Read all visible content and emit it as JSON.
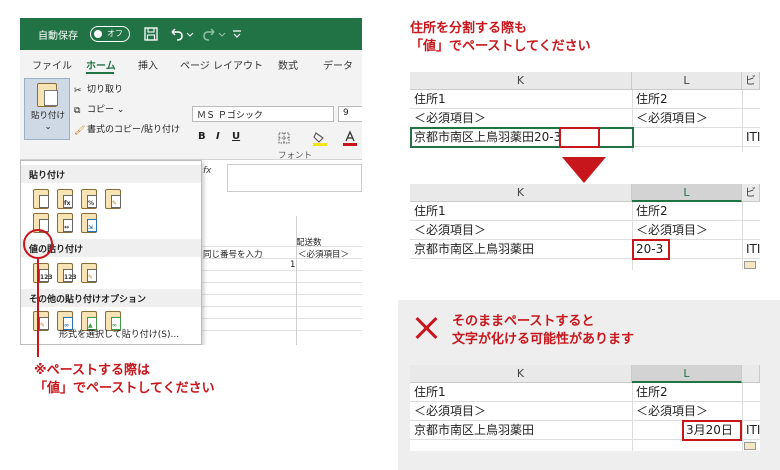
{
  "excel": {
    "titlebar": {
      "autosave": "自動保存",
      "toggle": "オフ",
      "save_icon": "save-icon",
      "undo_icon": "undo-icon"
    },
    "tabs": [
      "ファイル",
      "ホーム",
      "挿入",
      "ページ レイアウト",
      "数式",
      "データ"
    ],
    "ribbon": {
      "paste_label": "貼り付け",
      "cut": "切り取り",
      "copy": "コピー",
      "format_painter": "書式のコピー/貼り付け",
      "font_name": "ＭＳ Ｐゴシック",
      "font_size": "9",
      "font_group": "フォント",
      "bold": "B",
      "italic": "I",
      "underline": "U"
    },
    "sheet": {
      "fx": "fx",
      "same_number": "同じ番号を入力",
      "value_one": "1",
      "delivery": "配送数",
      "required": "＜必須項目＞"
    },
    "paste_menu": {
      "section_paste": "貼り付け",
      "section_values": "値の貼り付け",
      "section_other": "その他の貼り付けオプション",
      "paste_special": "形式を選択して貼り付け(S)...",
      "sub_123": "123"
    }
  },
  "annotations": {
    "left_note_line1": "※ペーストする際は",
    "left_note_line2": "「値」でペーストしてください",
    "top_note_line1": "住所を分割する際も",
    "top_note_line2": "「値」でペーストしてください",
    "bad_note_line1": "そのままペーストすると",
    "bad_note_line2": "文字が化ける可能性があります"
  },
  "tables": {
    "before": {
      "col_k": "K",
      "col_l": "L",
      "col_m_partial": "ビ",
      "r1_k": "住所1",
      "r1_l": "住所2",
      "r2_k": "＜必須項目＞",
      "r2_l": "＜必須項目＞",
      "r3_k_main": "京都市南区上鳥羽薬田",
      "r3_k_num": "20-3",
      "r3_m": "ITI"
    },
    "after": {
      "col_k": "K",
      "col_l": "L",
      "col_m_partial": "ビ",
      "r1_k": "住所1",
      "r1_l": "住所2",
      "r2_k": "＜必須項目＞",
      "r2_l": "＜必須項目＞",
      "r3_k": "京都市南区上鳥羽薬田",
      "r3_l": "20-3",
      "r3_m": "ITI"
    },
    "bad": {
      "col_k": "K",
      "col_l": "L",
      "r1_k": "住所1",
      "r1_l": "住所2",
      "r2_k": "＜必須項目＞",
      "r2_l": "＜必須項目＞",
      "r3_k": "京都市南区上鳥羽薬田",
      "r3_l": "3月20日",
      "r3_m": "ITI"
    }
  },
  "colors": {
    "excel_green": "#217346",
    "accent_red": "#c8161d",
    "bad_bg": "#eeeeee"
  }
}
